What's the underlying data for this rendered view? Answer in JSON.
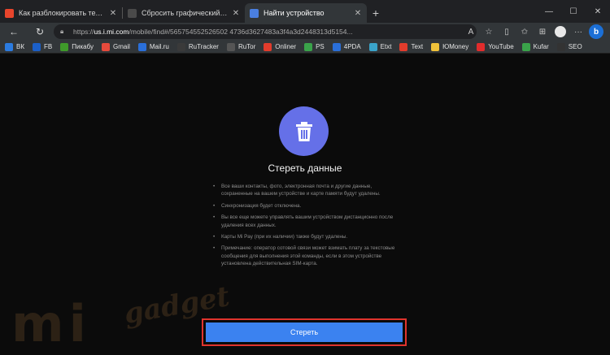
{
  "tabs": [
    {
      "title": "Как разблокировать телефон е",
      "favicon_color": "#e8452c",
      "active": false
    },
    {
      "title": "Сбросить графический ключ н",
      "favicon_color": "#4a4a4a",
      "active": false
    },
    {
      "title": "Найти устройство",
      "favicon_color": "#4a7fe0",
      "active": true
    }
  ],
  "new_tab_label": "+",
  "address": {
    "host": "us.i.mi.com",
    "path": "/mobile/find#/565754552526502 4736d3627483a3f4a3d2448313d5154...",
    "scheme": "https://"
  },
  "bookmarks": [
    {
      "label": "ВК",
      "color": "#2b7be0"
    },
    {
      "label": "FB",
      "color": "#1b5fc7"
    },
    {
      "label": "Пикабу",
      "color": "#3f9a2a"
    },
    {
      "label": "Gmail",
      "color": "#e64a3c"
    },
    {
      "label": "Mail.ru",
      "color": "#2a6fd9"
    },
    {
      "label": "RuTracker",
      "color": "#3a3a3a"
    },
    {
      "label": "RuTor",
      "color": "#555555"
    },
    {
      "label": "Onliner",
      "color": "#e23c2c"
    },
    {
      "label": "PS",
      "color": "#3aa34a"
    },
    {
      "label": "4PDA",
      "color": "#2a6fd9"
    },
    {
      "label": "Etxt",
      "color": "#3aa3c9"
    },
    {
      "label": "Text",
      "color": "#e23c2c"
    },
    {
      "label": "ЮMoney",
      "color": "#f0c23a"
    },
    {
      "label": "YouTube",
      "color": "#e22c2c"
    },
    {
      "label": "Kufar",
      "color": "#3aa34a"
    },
    {
      "label": "SEO",
      "color": "#333333"
    }
  ],
  "main": {
    "title": "Стереть данные",
    "bullets": [
      "Все ваши контакты, фото, электронная почта и другие данные, сохраненные на вашем устройстве и карте памяти будут удалены.",
      "Синхронизация будет отключена.",
      "Вы все еще можете управлять вашим устройством дистанционно после удаления всех данных.",
      "Карты Mi Pay (при их наличии) также будут удалены.",
      "Примечание: оператор сотовой связи может взимать плату за текстовые сообщения для выполнения этой команды, если в этом устройстве установлена действительная SIM-карта."
    ],
    "cta_label": "Стереть",
    "accent_color": "#6570e8",
    "cta_color": "#3b82f0",
    "highlight_color": "#e0342d"
  },
  "watermark": {
    "mi": "mi",
    "gadget": "gadget"
  }
}
